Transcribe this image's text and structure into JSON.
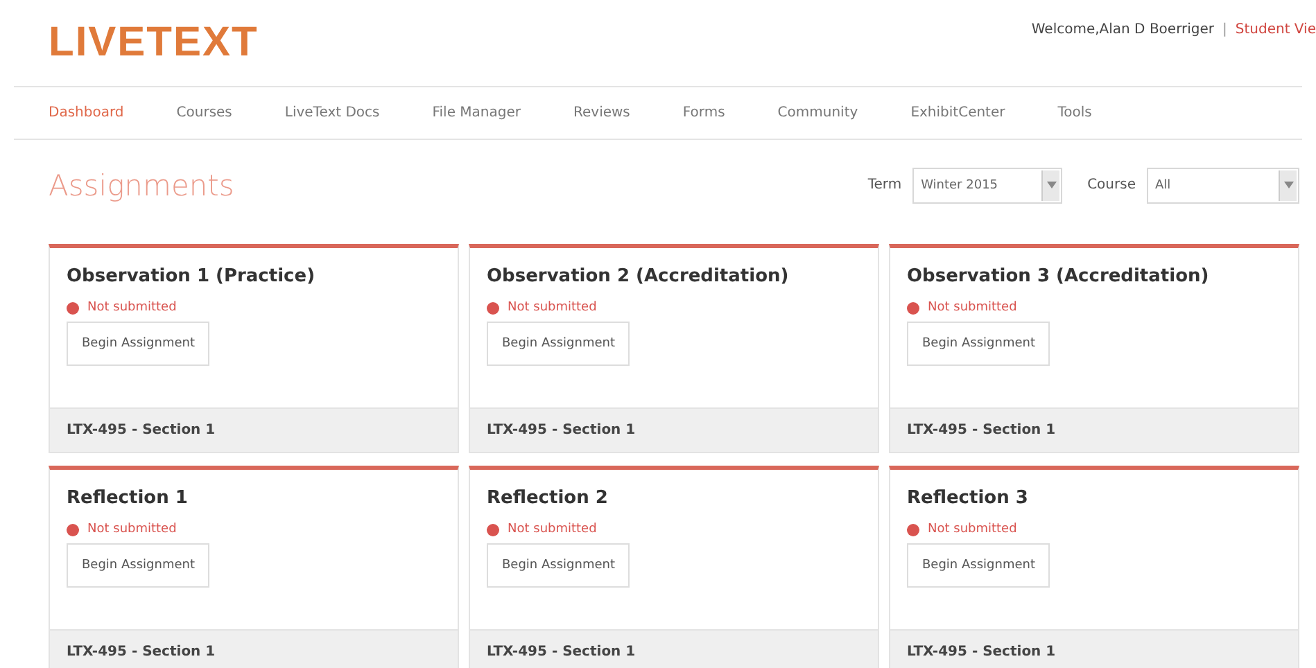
{
  "logo": "LIVETEXT",
  "header": {
    "welcome": "Welcome,Alan D Boerriger",
    "separator": "|",
    "link": "Student Vie"
  },
  "nav": [
    {
      "label": "Dashboard",
      "selected": true
    },
    {
      "label": "Courses",
      "selected": false
    },
    {
      "label": "LiveText Docs",
      "selected": false
    },
    {
      "label": "File Manager",
      "selected": false
    },
    {
      "label": "Reviews",
      "selected": false
    },
    {
      "label": "Forms",
      "selected": false
    },
    {
      "label": "Community",
      "selected": false
    },
    {
      "label": "ExhibitCenter",
      "selected": false
    },
    {
      "label": "Tools",
      "selected": false
    }
  ],
  "page_title": "Assignments",
  "filters": [
    {
      "label": "Term",
      "value": "Winter 2015"
    },
    {
      "label": "Course",
      "value": "All"
    }
  ],
  "assignments": [
    {
      "title": "Observation 1 (Practice)",
      "status": "Not submitted",
      "submitted": false,
      "button": "Begin Assignment",
      "section": "LTX-495 - Section 1"
    },
    {
      "title": "Observation 2 (Accreditation)",
      "status": "Not submitted",
      "submitted": false,
      "button": "Begin Assignment",
      "section": "LTX-495 - Section 1"
    },
    {
      "title": "Observation 3 (Accreditation)",
      "status": "Not submitted",
      "submitted": false,
      "button": "Begin Assignment",
      "section": "LTX-495 - Section 1"
    },
    {
      "title": "Reflection 1",
      "status": "Not submitted",
      "submitted": false,
      "button": "Begin Assignment",
      "section": "LTX-495 - Section 1"
    },
    {
      "title": "Reflection 2",
      "status": "Not submitted",
      "submitted": false,
      "button": "Begin Assignment",
      "section": "LTX-495 - Section 1"
    },
    {
      "title": "Reflection 3",
      "status": "Not submitted",
      "submitted": false,
      "button": "Begin Assignment",
      "section": "LTX-495 - Section 1"
    }
  ]
}
